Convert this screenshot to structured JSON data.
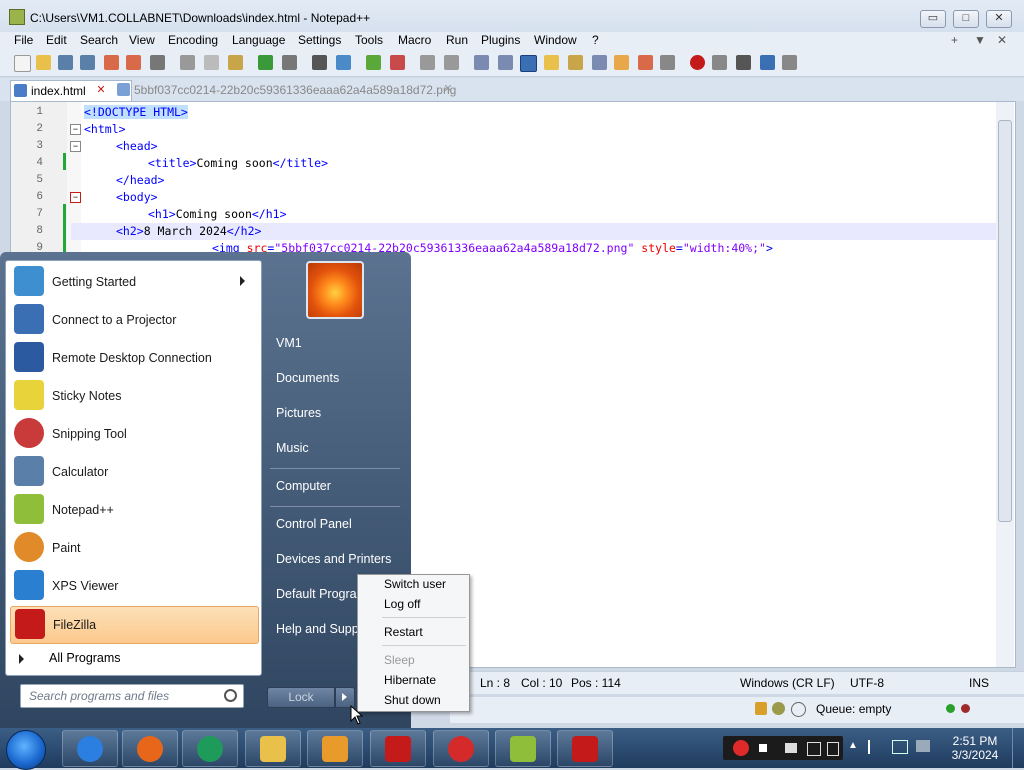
{
  "window": {
    "title": "C:\\Users\\VM1.COLLABNET\\Downloads\\index.html - Notepad++",
    "min": "▭",
    "max": "□",
    "close": "✕"
  },
  "menubar": {
    "items": [
      "File",
      "Edit",
      "Search",
      "View",
      "Encoding",
      "Language",
      "Settings",
      "Tools",
      "Macro",
      "Run",
      "Plugins",
      "Window",
      "?"
    ],
    "right": [
      "+",
      "▼",
      "✕"
    ]
  },
  "tabs": [
    {
      "label": "index.html",
      "active": true
    },
    {
      "label": "5bbf037cc0214-22b20c59361336eaaa62a4a589a18d72.png",
      "active": false
    }
  ],
  "editor": {
    "line_numbers": [
      "1",
      "2",
      "3",
      "4",
      "5",
      "6",
      "7",
      "8",
      "9"
    ],
    "lines": [
      {
        "a": "<!DOCTYPE HTML>"
      },
      {
        "a": "<html>"
      },
      {
        "a": "<head>"
      },
      {
        "a": "<title>",
        "b": "Coming soon",
        "c": "</title>"
      },
      {
        "a": "</head>"
      },
      {
        "a": "<body>"
      },
      {
        "a": "<h1>",
        "b": "Coming soon",
        "c": "</h1>"
      },
      {
        "a": "<h2>",
        "b": "8 March 2024",
        "c": "</h2>"
      },
      {
        "a": "<img ",
        "d": "src",
        "e": "=",
        "f": "\"5bbf037cc0214-22b20c59361336eaaa62a4a589a18d72.png\"",
        "g": " style",
        "h": "=",
        "i": "\"width:40%;\"",
        "j": ">"
      }
    ]
  },
  "statusbar": {
    "ln": "Ln : 8",
    "col": "Col : 10",
    "pos": "Pos : 114",
    "eol": "Windows (CR LF)",
    "enc": "UTF-8",
    "mode": "INS"
  },
  "ftp": {
    "queue": "Queue: empty"
  },
  "start_menu": {
    "programs": [
      {
        "label": "Getting Started",
        "submenu": true,
        "color": "#3d8fcf"
      },
      {
        "label": "Connect to a Projector",
        "color": "#3a6fb3"
      },
      {
        "label": "Remote Desktop Connection",
        "color": "#2c5aa0"
      },
      {
        "label": "Sticky Notes",
        "color": "#e8d43a"
      },
      {
        "label": "Snipping Tool",
        "color": "#c93a3a"
      },
      {
        "label": "Calculator",
        "color": "#5a7fa8"
      },
      {
        "label": "Notepad++",
        "color": "#8fbf3a"
      },
      {
        "label": "Paint",
        "color": "#e08a2a"
      },
      {
        "label": "XPS Viewer",
        "color": "#2a7fd0"
      },
      {
        "label": "FileZilla",
        "color": "#c41a1a",
        "highlight": true
      }
    ],
    "all_programs": "All Programs",
    "search_placeholder": "Search programs and files",
    "right_items": [
      "VM1",
      "Documents",
      "Pictures",
      "Music",
      "Computer",
      "Control Panel",
      "Devices and Printers",
      "Default Programs",
      "Help and Support"
    ],
    "lock_label": "Lock"
  },
  "power_menu": {
    "items": [
      {
        "label": "Switch user",
        "disabled": false
      },
      {
        "label": "Log off",
        "disabled": false
      },
      {
        "label": "Restart",
        "disabled": false
      },
      {
        "label": "Sleep",
        "disabled": true
      },
      {
        "label": "Hibernate",
        "disabled": false
      },
      {
        "label": "Shut down",
        "disabled": false
      }
    ]
  },
  "taskbar": {
    "time": "2:51 PM",
    "date": "3/3/2024",
    "apps": [
      {
        "name": "internet-explorer-icon",
        "color": "#2b7fe0"
      },
      {
        "name": "firefox-icon",
        "color": "#e8661a"
      },
      {
        "name": "media-center-icon",
        "color": "#1e9a5a"
      },
      {
        "name": "explorer-icon",
        "color": "#e8c04a"
      },
      {
        "name": "media-player-icon",
        "color": "#e89a2a"
      },
      {
        "name": "filezilla-icon",
        "color": "#c41a1a"
      },
      {
        "name": "record-icon",
        "color": "#d42a2a"
      },
      {
        "name": "notepadpp-icon",
        "color": "#8fbf3a"
      },
      {
        "name": "flash-icon",
        "color": "#c41a1a"
      }
    ]
  }
}
